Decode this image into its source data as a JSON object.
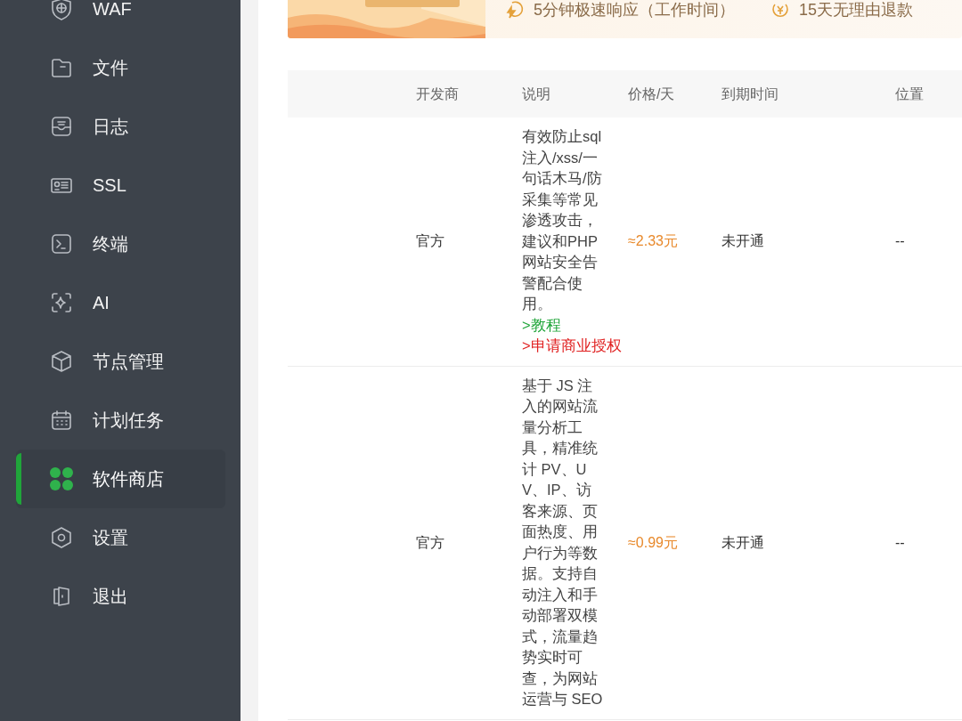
{
  "sidebar": {
    "items": [
      {
        "label": "WAF",
        "selected": false
      },
      {
        "label": "文件",
        "selected": false
      },
      {
        "label": "日志",
        "selected": false
      },
      {
        "label": "SSL",
        "selected": false
      },
      {
        "label": "终端",
        "selected": false
      },
      {
        "label": "AI",
        "selected": false
      },
      {
        "label": "节点管理",
        "selected": false
      },
      {
        "label": "计划任务",
        "selected": false
      },
      {
        "label": "软件商店",
        "selected": true
      },
      {
        "label": "设置",
        "selected": false
      },
      {
        "label": "退出",
        "selected": false
      }
    ]
  },
  "banner": {
    "features": [
      {
        "text": "5分钟极速响应（工作时间）"
      },
      {
        "text": "15天无理由退款"
      }
    ]
  },
  "table": {
    "columns": [
      "开发商",
      "说明",
      "价格/天",
      "到期时间",
      "位置"
    ],
    "rows": [
      {
        "developer": "官方",
        "description": "有效防止sql注入/xss/一句话木马/防采集等常见渗透攻击，建议和PHP网站安全告警配合使用。",
        "tutorial_link": ">教程",
        "license_link": ">申请商业授权",
        "price": "≈2.33元",
        "expiry": "未开通",
        "location": "--"
      },
      {
        "developer": "官方",
        "description": "基于 JS 注入的网站流量分析工具，精准统计 PV、UV、IP、访客来源、页面热度、用户行为等数据。支持自动注入和手动部署双模式，流量趋势实时可查，为网站运营与 SEO",
        "price": "≈0.99元",
        "expiry": "未开通",
        "location": "--"
      }
    ]
  }
}
